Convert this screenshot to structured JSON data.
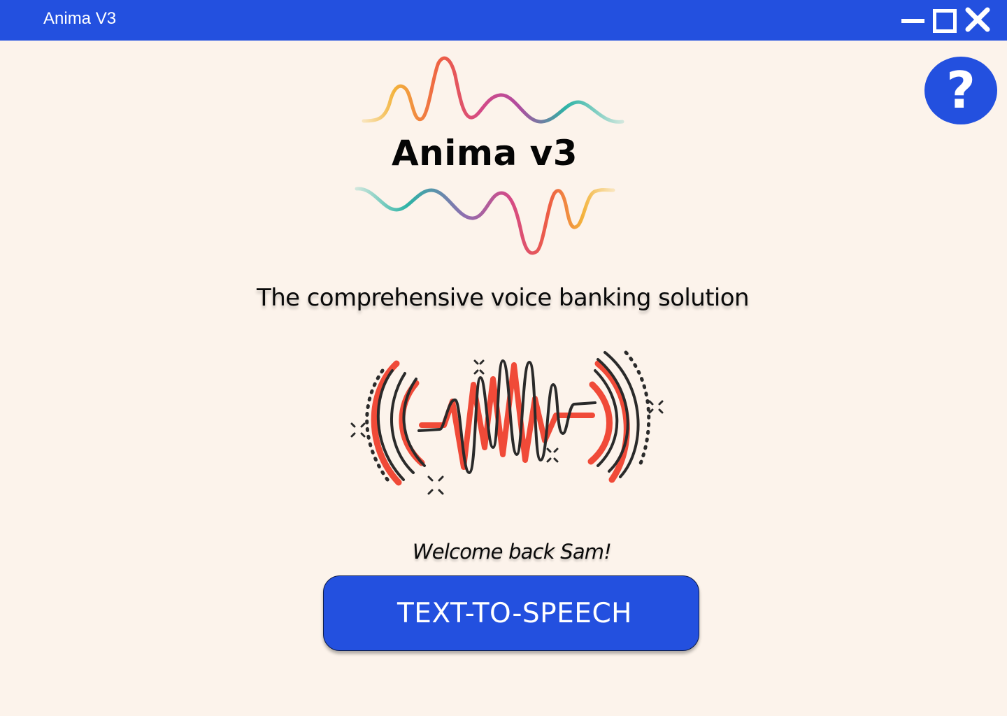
{
  "window": {
    "title": "Anima V3",
    "controls": {
      "minimize_icon": "minimize-icon",
      "maximize_icon": "maximize-icon",
      "close_icon": "close-icon"
    }
  },
  "help": {
    "icon": "question-mark-icon",
    "glyph": "?"
  },
  "logo": {
    "name": "Anima v3",
    "wave_colors": [
      "#f3b23c",
      "#ee6b3b",
      "#d94f78",
      "#b14a9c",
      "#6d8ab8",
      "#1fb3a2"
    ]
  },
  "main": {
    "tagline": "The comprehensive voice banking solution",
    "illustration_icon": "sound-wave-icon",
    "welcome": "Welcome back Sam!",
    "tts_button_label": "TEXT-TO-SPEECH"
  },
  "colors": {
    "accent": "#2350df",
    "background": "#fcf3eb",
    "illustration_red": "#f04a38",
    "illustration_outline": "#2a2a2a"
  }
}
